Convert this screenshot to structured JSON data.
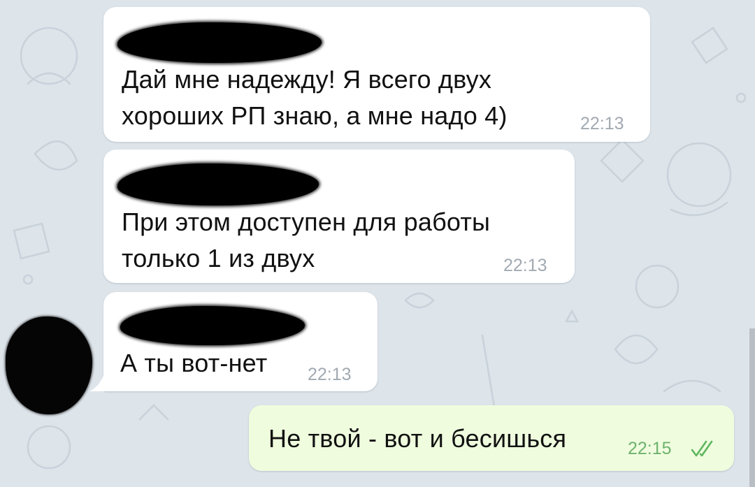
{
  "chat": {
    "messages": [
      {
        "text": "Дай мне надежду! Я всего двух\nхороших РП знаю, а мне надо 4)",
        "time": "22:13",
        "direction": "incoming",
        "sender_hidden": true
      },
      {
        "text": "При этом доступен для работы\nтолько 1 из двух",
        "time": "22:13",
        "direction": "incoming",
        "sender_hidden": true
      },
      {
        "text": "А ты вот-нет",
        "time": "22:13",
        "direction": "incoming",
        "sender_hidden": true
      },
      {
        "text": "Не твой - вот и бесишься",
        "time": "22:15",
        "direction": "outgoing",
        "status": "read"
      }
    ]
  },
  "colors": {
    "background": "#dde4ea",
    "incoming_bubble": "#ffffff",
    "outgoing_bubble": "#effdde",
    "read_check": "#5fb65f"
  },
  "icons": {
    "read_status": "double-check-icon",
    "avatar": "avatar",
    "wallpaper": "doodle-pattern"
  }
}
